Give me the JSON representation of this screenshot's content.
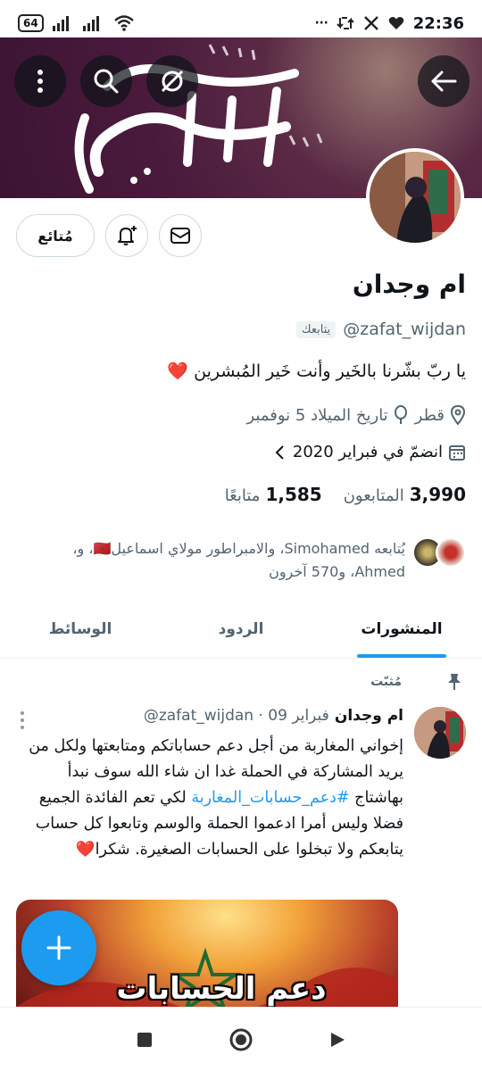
{
  "status_bar": {
    "battery": "64",
    "time": "22:36"
  },
  "banner": {
    "calligraphy_alt": "ستفرج"
  },
  "profile": {
    "display_name": "ام وجدان",
    "handle": "@zafat_wijdan",
    "follows_you": "يتابعك",
    "bio": "يا ربّ بشّرنا بالخَير وأنت خَير المُبشرين",
    "bio_emoji": "❤️",
    "location": "قطر",
    "birthday": "تاريخ الميلاد 5 نوفمبر",
    "joined": "انضمّ في فبراير 2020",
    "following_count": "1,585",
    "following_label": "متابعًا",
    "followers_count": "3,990",
    "followers_label": "المتابعون",
    "followed_by_text": "يُتابعه Simohamed، والامبراطور مولاي اسماعيل🇲🇦، و، Ahmed، و570 آخرون"
  },
  "actions": {
    "results_label": "مُتائع"
  },
  "tabs": [
    {
      "label": "المنشورات",
      "active": true
    },
    {
      "label": "الردود",
      "active": false
    },
    {
      "label": "الوسائط",
      "active": false
    }
  ],
  "pinned": {
    "label": "مُثبّت"
  },
  "tweet": {
    "name": "ام وجدان",
    "meta": "@zafat_wijdan · 09 فبراير",
    "text_before": "إخواني المغاربة من أجل دعم حساباتكم ومتابعتها ولكل من يريد المشاركة في الحملة غدا ان شاء الله سوف نبدأ بهاشتاج ",
    "hashtag": "#دعم_حسابات_المغاربة",
    "text_after": " لكي تعم الفائدة الجميع فضلا وليس أمرا ادعموا الحملة والوسم وتابعوا كل حساب يتابعكم ولا تبخلوا على الحسابات الصغيرة. شكرا❤️",
    "image_caption": "دعم الحسابات المغربية"
  },
  "colors": {
    "accent": "#1d9bf0",
    "text": "#0f1419",
    "muted": "#536471",
    "heart": "#e0245e"
  }
}
